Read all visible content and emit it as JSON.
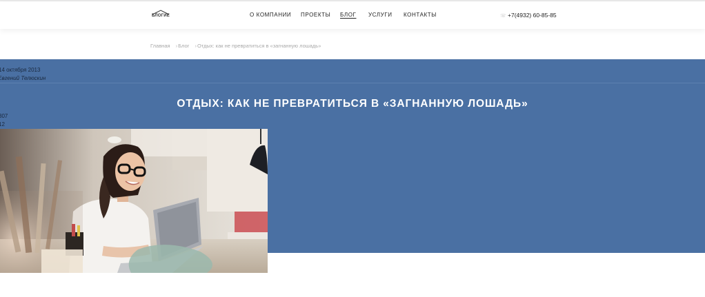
{
  "header": {
    "logo_text": "БЛОГИЕ",
    "nav": [
      {
        "label": "О КОМПАНИИ",
        "active": false
      },
      {
        "label": "ПРОЕКТЫ",
        "active": false
      },
      {
        "label": "БЛОГ",
        "active": true
      },
      {
        "label": "УСЛУГИ",
        "active": false
      },
      {
        "label": "КОНТАКТЫ",
        "active": false
      }
    ],
    "phone": "+7(4932) 60-85-85",
    "phone_icon": "phone-icon"
  },
  "breadcrumb": {
    "home": "Главная",
    "section": "Блог",
    "current": "Отдых: как не превратиться в «загнанную лошадь»",
    "separator": "›"
  },
  "article": {
    "date": "14 октября 2013",
    "author": "Евгений Телюскин",
    "title": "ОТДЫХ: КАК НЕ ПРЕВРАТИТЬСЯ В «ЗАГНАННУЮ ЛОШАДЬ»",
    "stat_1": "307",
    "stat_2": "12"
  },
  "colors": {
    "hero_background": "#4a70a3",
    "title_text": "#ffffff",
    "breadcrumb_text": "#a8a8a8"
  }
}
